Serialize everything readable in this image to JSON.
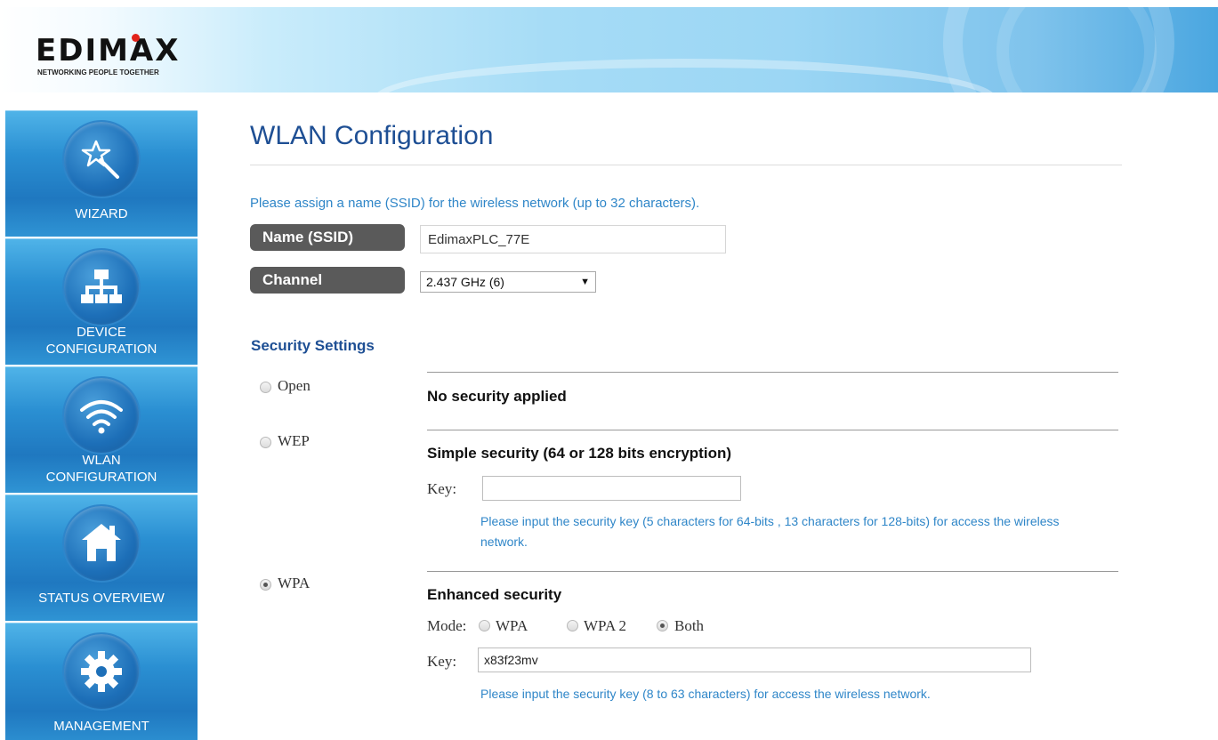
{
  "header": {
    "logo_text": "EDIMAX",
    "logo_tagline": "NETWORKING PEOPLE TOGETHER"
  },
  "sidebar": {
    "items": [
      {
        "label": "WIZARD",
        "icon": "wand-icon"
      },
      {
        "label_line1": "DEVICE",
        "label_line2": "CONFIGURATION",
        "icon": "network-icon"
      },
      {
        "label_line1": "WLAN",
        "label_line2": "CONFIGURATION",
        "icon": "wifi-icon"
      },
      {
        "label": "STATUS OVERVIEW",
        "icon": "home-icon"
      },
      {
        "label": "MANAGEMENT",
        "icon": "gear-icon"
      }
    ]
  },
  "main": {
    "title": "WLAN Configuration",
    "ssid_hint": "Please assign a name (SSID) for the wireless network (up to 32 characters).",
    "ssid_label": "Name (SSID)",
    "ssid_value": "EdimaxPLC_77E",
    "channel_label": "Channel",
    "channel_value": "2.437 GHz (6)"
  },
  "security": {
    "heading": "Security Settings",
    "open": {
      "option_label": "Open",
      "description": "No security applied",
      "selected": false
    },
    "wep": {
      "option_label": "WEP",
      "description": "Simple security (64 or 128 bits encryption)",
      "key_label": "Key:",
      "key_value": "",
      "hint": "Please input the security key (5 characters for 64-bits , 13 characters for 128-bits) for access the wireless network.",
      "selected": false
    },
    "wpa": {
      "option_label": "WPA",
      "description": "Enhanced security",
      "mode_label": "Mode:",
      "modes": [
        {
          "label": "WPA",
          "selected": false
        },
        {
          "label": "WPA 2",
          "selected": false
        },
        {
          "label": "Both",
          "selected": true
        }
      ],
      "key_label": "Key:",
      "key_value": "x83f23mv",
      "hint": "Please input the security key (8 to 63 characters) for access the wireless network.",
      "selected": true
    }
  },
  "colors": {
    "title_blue": "#1e4f94",
    "hint_blue": "#2f86c8",
    "sidebar_blue": "#2a8fd2",
    "label_gray": "#5a5a5a",
    "logo_dot_red": "#e2231a"
  }
}
